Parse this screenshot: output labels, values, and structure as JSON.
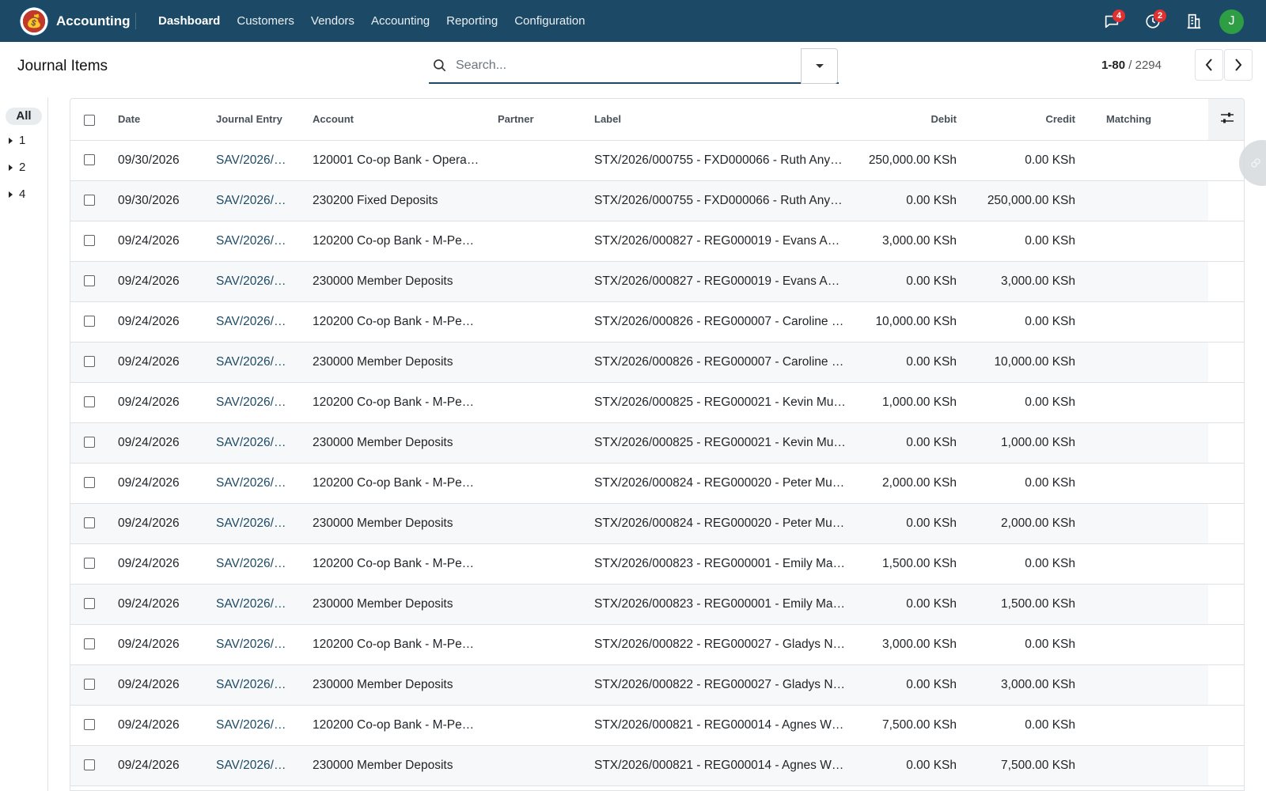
{
  "navbar": {
    "app_name": "Accounting",
    "menu": [
      "Dashboard",
      "Customers",
      "Vendors",
      "Accounting",
      "Reporting",
      "Configuration"
    ],
    "messages_count": "4",
    "activities_count": "2",
    "avatar_initial": "J",
    "colors": {
      "bar": "#1c4a66",
      "badge": "#e03131",
      "avatar": "#2e9e44"
    }
  },
  "control_panel": {
    "title": "Journal Items",
    "search_placeholder": "Search...",
    "pager_value": "1-80",
    "pager_sep": " / ",
    "pager_limit": "2294"
  },
  "side_panel": {
    "all_label": "All",
    "groups": [
      "1",
      "2",
      "4"
    ]
  },
  "table": {
    "columns": [
      "Date",
      "Journal Entry",
      "Account",
      "Partner",
      "Label",
      "Debit",
      "Credit",
      "Matching"
    ],
    "rows": [
      {
        "date": "09/30/2026",
        "entry": "SAV/2026/…",
        "account": "120001 Co-op Bank - Opera…",
        "partner": "",
        "label": "STX/2026/000755 - FXD000066 - Ruth Any…",
        "debit": "250,000.00 KSh",
        "credit": "0.00 KSh",
        "matching": ""
      },
      {
        "date": "09/30/2026",
        "entry": "SAV/2026/…",
        "account": "230200 Fixed Deposits",
        "partner": "",
        "label": "STX/2026/000755 - FXD000066 - Ruth Any…",
        "debit": "0.00 KSh",
        "credit": "250,000.00 KSh",
        "matching": ""
      },
      {
        "date": "09/24/2026",
        "entry": "SAV/2026/…",
        "account": "120200 Co-op Bank - M-Pe…",
        "partner": "",
        "label": "STX/2026/000827 - REG000019 - Evans A…",
        "debit": "3,000.00 KSh",
        "credit": "0.00 KSh",
        "matching": ""
      },
      {
        "date": "09/24/2026",
        "entry": "SAV/2026/…",
        "account": "230000 Member Deposits",
        "partner": "",
        "label": "STX/2026/000827 - REG000019 - Evans A…",
        "debit": "0.00 KSh",
        "credit": "3,000.00 KSh",
        "matching": ""
      },
      {
        "date": "09/24/2026",
        "entry": "SAV/2026/…",
        "account": "120200 Co-op Bank - M-Pe…",
        "partner": "",
        "label": "STX/2026/000826 - REG000007 - Caroline …",
        "debit": "10,000.00 KSh",
        "credit": "0.00 KSh",
        "matching": ""
      },
      {
        "date": "09/24/2026",
        "entry": "SAV/2026/…",
        "account": "230000 Member Deposits",
        "partner": "",
        "label": "STX/2026/000826 - REG000007 - Caroline …",
        "debit": "0.00 KSh",
        "credit": "10,000.00 KSh",
        "matching": ""
      },
      {
        "date": "09/24/2026",
        "entry": "SAV/2026/…",
        "account": "120200 Co-op Bank - M-Pe…",
        "partner": "",
        "label": "STX/2026/000825 - REG000021 - Kevin Mu…",
        "debit": "1,000.00 KSh",
        "credit": "0.00 KSh",
        "matching": ""
      },
      {
        "date": "09/24/2026",
        "entry": "SAV/2026/…",
        "account": "230000 Member Deposits",
        "partner": "",
        "label": "STX/2026/000825 - REG000021 - Kevin Mu…",
        "debit": "0.00 KSh",
        "credit": "1,000.00 KSh",
        "matching": ""
      },
      {
        "date": "09/24/2026",
        "entry": "SAV/2026/…",
        "account": "120200 Co-op Bank - M-Pe…",
        "partner": "",
        "label": "STX/2026/000824 - REG000020 - Peter Mu…",
        "debit": "2,000.00 KSh",
        "credit": "0.00 KSh",
        "matching": ""
      },
      {
        "date": "09/24/2026",
        "entry": "SAV/2026/…",
        "account": "230000 Member Deposits",
        "partner": "",
        "label": "STX/2026/000824 - REG000020 - Peter Mu…",
        "debit": "0.00 KSh",
        "credit": "2,000.00 KSh",
        "matching": ""
      },
      {
        "date": "09/24/2026",
        "entry": "SAV/2026/…",
        "account": "120200 Co-op Bank - M-Pe…",
        "partner": "",
        "label": "STX/2026/000823 - REG000001 - Emily Ma…",
        "debit": "1,500.00 KSh",
        "credit": "0.00 KSh",
        "matching": ""
      },
      {
        "date": "09/24/2026",
        "entry": "SAV/2026/…",
        "account": "230000 Member Deposits",
        "partner": "",
        "label": "STX/2026/000823 - REG000001 - Emily Ma…",
        "debit": "0.00 KSh",
        "credit": "1,500.00 KSh",
        "matching": ""
      },
      {
        "date": "09/24/2026",
        "entry": "SAV/2026/…",
        "account": "120200 Co-op Bank - M-Pe…",
        "partner": "",
        "label": "STX/2026/000822 - REG000027 - Gladys N…",
        "debit": "3,000.00 KSh",
        "credit": "0.00 KSh",
        "matching": ""
      },
      {
        "date": "09/24/2026",
        "entry": "SAV/2026/…",
        "account": "230000 Member Deposits",
        "partner": "",
        "label": "STX/2026/000822 - REG000027 - Gladys N…",
        "debit": "0.00 KSh",
        "credit": "3,000.00 KSh",
        "matching": ""
      },
      {
        "date": "09/24/2026",
        "entry": "SAV/2026/…",
        "account": "120200 Co-op Bank - M-Pe…",
        "partner": "",
        "label": "STX/2026/000821 - REG000014 - Agnes W…",
        "debit": "7,500.00 KSh",
        "credit": "0.00 KSh",
        "matching": ""
      },
      {
        "date": "09/24/2026",
        "entry": "SAV/2026/…",
        "account": "230000 Member Deposits",
        "partner": "",
        "label": "STX/2026/000821 - REG000014 - Agnes W…",
        "debit": "0.00 KSh",
        "credit": "7,500.00 KSh",
        "matching": ""
      }
    ]
  },
  "icons": {
    "logo": "money-bag-icon",
    "messages": "chat-bubble-icon",
    "activities": "clock-icon",
    "company": "building-icon",
    "search": "search-icon",
    "search_toggle": "caret-down-icon",
    "optional_columns": "sliders-icon"
  }
}
